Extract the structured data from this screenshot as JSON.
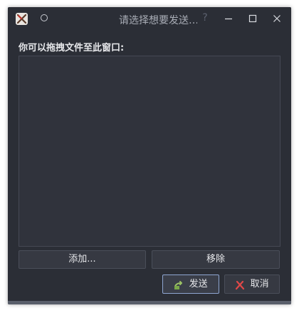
{
  "window": {
    "title": "请选择想要发送…",
    "help_glyph": "?"
  },
  "titlebar": {
    "icons": [
      "app-icon",
      "pin-icon",
      "help-icon",
      "minimize-icon",
      "maximize-icon",
      "close-icon"
    ]
  },
  "content": {
    "drag_label": "你可以拖拽文件至此窗口:",
    "files": []
  },
  "buttons": {
    "add_label": "添加...",
    "remove_label": "移除",
    "send_label": "发送",
    "cancel_label": "取消"
  },
  "colors": {
    "background": "#2b2e36",
    "list_background": "#30333c",
    "text": "#e6e7ea",
    "focus_border": "#8ea6d2",
    "cancel_icon": "#e04848",
    "send_icon": "#7aa84a"
  }
}
